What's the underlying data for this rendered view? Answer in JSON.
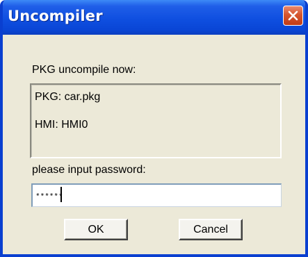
{
  "window": {
    "title": "Uncompiler"
  },
  "dialog": {
    "heading": "PKG uncompile now:",
    "pkg_line": "PKG:  car.pkg",
    "hmi_line": "HMI:  HMI0",
    "password_prompt": "please input password:",
    "password_value": "******"
  },
  "buttons": {
    "ok_label": "OK",
    "cancel_label": "Cancel"
  },
  "icons": {
    "close": "close-icon"
  },
  "colors": {
    "titlebar": "#0a46d6",
    "close_button": "#d6562f",
    "dialog_background": "#ece9d8"
  }
}
